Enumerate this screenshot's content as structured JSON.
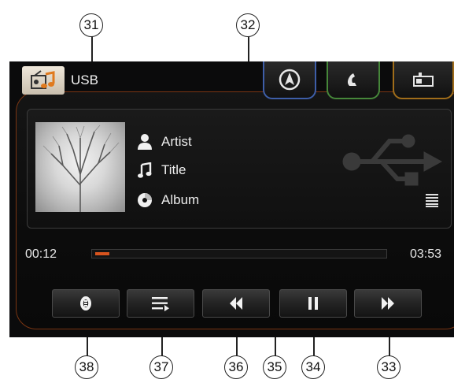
{
  "callouts": {
    "c31": "31",
    "c32": "32",
    "c33": "33",
    "c34": "34",
    "c35": "35",
    "c36": "36",
    "c37": "37",
    "c38": "38"
  },
  "header": {
    "source_label": "USB",
    "source_icon": "radio-music-icon"
  },
  "tabs": [
    {
      "name": "navigation",
      "icon": "navigation-icon",
      "color": "#3e5ea8"
    },
    {
      "name": "phone",
      "icon": "phone-icon",
      "color": "#46873a"
    },
    {
      "name": "media",
      "icon": "media-icon",
      "color": "#a06d1a"
    }
  ],
  "track": {
    "artist": "Artist",
    "title": "Title",
    "album": "Album"
  },
  "playback": {
    "elapsed": "00:12",
    "total": "03:53",
    "progress_fraction": 0.05
  },
  "controls": [
    {
      "name": "repeat-shuffle",
      "icon": "repeat-icon"
    },
    {
      "name": "list",
      "icon": "list-icon"
    },
    {
      "name": "previous",
      "icon": "rewind-icon"
    },
    {
      "name": "pause",
      "icon": "pause-icon"
    },
    {
      "name": "next",
      "icon": "fast-forward-icon"
    }
  ],
  "colors": {
    "accent": "#d8541e",
    "frame": "#7a3512"
  }
}
